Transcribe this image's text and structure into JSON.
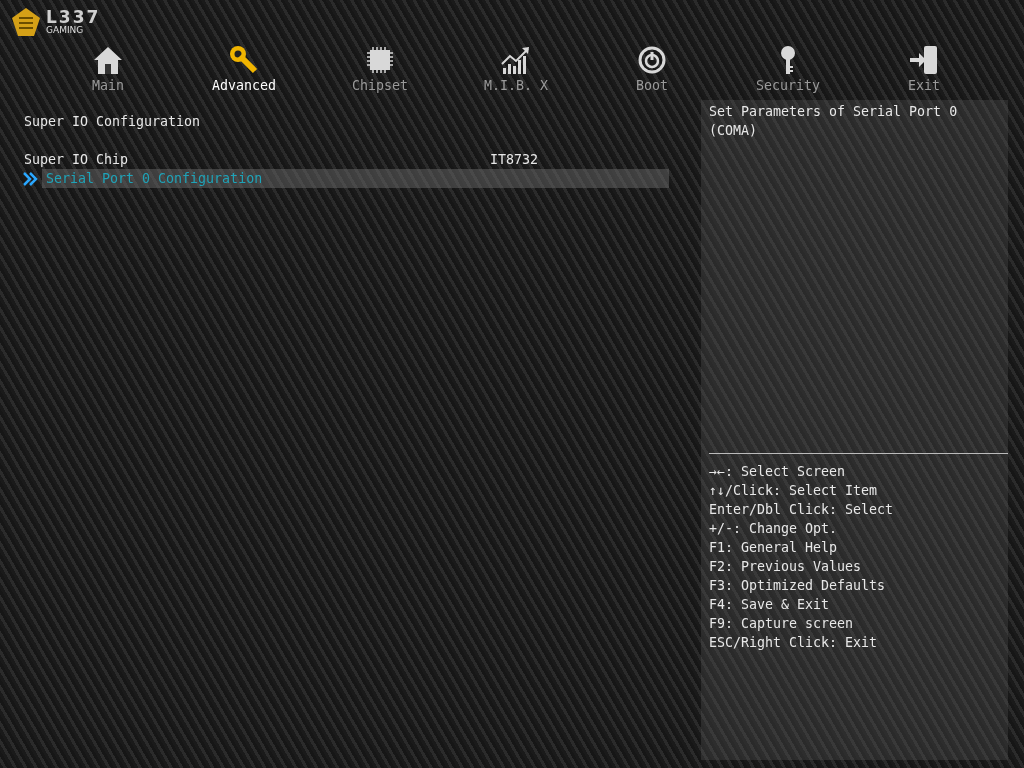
{
  "logo": {
    "brand": "L337",
    "tagline": "GAMING"
  },
  "tabs": [
    {
      "label": "Main",
      "selected": false
    },
    {
      "label": "Advanced",
      "selected": true
    },
    {
      "label": "Chipset",
      "selected": false
    },
    {
      "label": "M.I.B. X",
      "selected": false
    },
    {
      "label": "Boot",
      "selected": false
    },
    {
      "label": "Security",
      "selected": false
    },
    {
      "label": "Exit",
      "selected": false
    }
  ],
  "menu": [
    {
      "kind": "heading",
      "label": "Super IO Configuration"
    },
    {
      "kind": "setting",
      "label": "Super IO Chip",
      "value": "IT8732"
    },
    {
      "kind": "submenu",
      "label": "Serial Port 0 Configuration",
      "selected": true
    }
  ],
  "help": {
    "description": "Set Parameters of Serial Port 0 (COMA)",
    "keys": [
      "→←: Select Screen",
      "↑↓/Click: Select Item",
      "Enter/Dbl Click: Select",
      "+/-: Change Opt.",
      "F1: General Help",
      "F2: Previous Values",
      "F3: Optimized Defaults",
      "F4: Save & Exit",
      "F9: Capture screen",
      "ESC/Right Click: Exit"
    ]
  }
}
